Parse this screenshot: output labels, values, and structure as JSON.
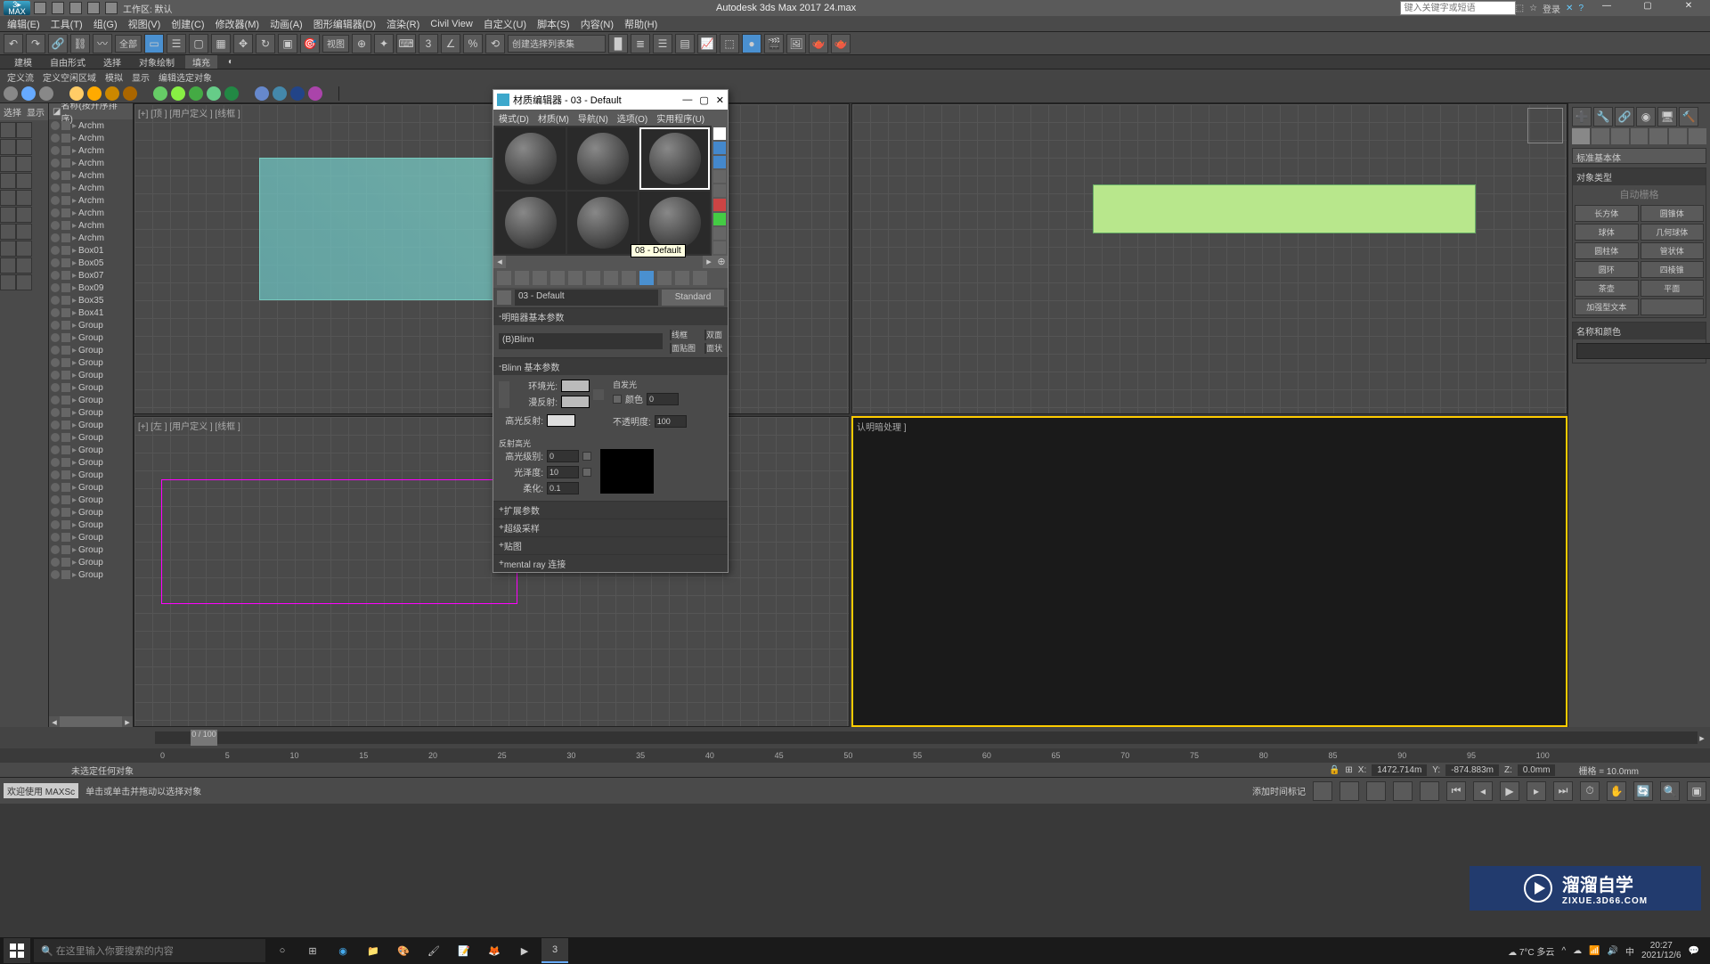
{
  "app": {
    "title_center": "Autodesk 3ds Max 2017    24.max",
    "workspace": "工作区: 默认",
    "search_placeholder": "键入关键字或短语",
    "login": "登录"
  },
  "menubar": [
    "编辑(E)",
    "工具(T)",
    "组(G)",
    "视图(V)",
    "创建(C)",
    "修改器(M)",
    "动画(A)",
    "图形编辑器(D)",
    "渲染(R)",
    "Civil View",
    "自定义(U)",
    "脚本(S)",
    "内容(N)",
    "帮助(H)"
  ],
  "toolbar": {
    "filter_label": "全部",
    "selection_label": "创建选择列表集",
    "view_label": "视图"
  },
  "ribbon": {
    "tabs": [
      "建模",
      "自由形式",
      "选择",
      "对象绘制",
      "填充"
    ],
    "sub": [
      "定义流",
      "定义空闲区域",
      "模拟",
      "显示",
      "编辑选定对象"
    ]
  },
  "scene": {
    "header": "名称(按升序排序)",
    "select": "选择",
    "display": "显示",
    "items": [
      "Archm",
      "Archm",
      "Archm",
      "Archm",
      "Archm",
      "Archm",
      "Archm",
      "Archm",
      "Archm",
      "Archm",
      "Box01",
      "Box05",
      "Box07",
      "Box09",
      "Box35",
      "Box41",
      "Group",
      "Group",
      "Group",
      "Group",
      "Group",
      "Group",
      "Group",
      "Group",
      "Group",
      "Group",
      "Group",
      "Group",
      "Group",
      "Group",
      "Group",
      "Group",
      "Group",
      "Group",
      "Group",
      "Group",
      "Group"
    ]
  },
  "viewports": {
    "vp1": "[+] [顶 ] [用户定义 ] [线框 ]",
    "vp2": "",
    "vp3": "[+] [左 ] [用户定义 ] [线框 ]",
    "vp4": "认明暗处理 ]"
  },
  "right": {
    "category": "标准基本体",
    "section1": "对象类型",
    "autogrid": "自动栅格",
    "buttons": [
      [
        "长方体",
        "圆锥体"
      ],
      [
        "球体",
        "几何球体"
      ],
      [
        "圆柱体",
        "管状体"
      ],
      [
        "圆环",
        "四棱锥"
      ],
      [
        "茶壶",
        "平面"
      ],
      [
        "加强型文本",
        ""
      ]
    ],
    "section2": "名称和颜色"
  },
  "mat": {
    "title": "材质编辑器 - 03 - Default",
    "menu": [
      "模式(D)",
      "材质(M)",
      "导航(N)",
      "选项(O)",
      "实用程序(U)"
    ],
    "tooltip": "08 - Default",
    "name": "03 - Default",
    "type": "Standard",
    "rollouts": {
      "shader": "明暗器基本参数",
      "shader_type": "(B)Blinn",
      "cb_wire": "线框",
      "cb_2side": "双面",
      "cb_facemap": "面贴图",
      "cb_faceted": "面状",
      "blinn": "Blinn 基本参数",
      "ambient": "环境光:",
      "diffuse": "漫反射:",
      "specular": "高光反射:",
      "selfillum": "自发光",
      "color_cb": "颜色",
      "color_val": "0",
      "opacity": "不透明度:",
      "opacity_val": "100",
      "spec_hl": "反射高光",
      "spec_level": "高光级别:",
      "spec_level_val": "0",
      "gloss": "光泽度:",
      "gloss_val": "10",
      "soften": "柔化:",
      "soften_val": "0.1",
      "ext": "扩展参数",
      "ss": "超级采样",
      "maps": "贴图",
      "mr": "mental ray 连接"
    }
  },
  "timeline": {
    "pos": "0 / 100",
    "ticks": [
      "0",
      "5",
      "10",
      "15",
      "20",
      "25",
      "30",
      "35",
      "40",
      "45",
      "50",
      "55",
      "60",
      "65",
      "70",
      "75",
      "80",
      "85",
      "90",
      "95",
      "100"
    ]
  },
  "status": {
    "line1": "未选定任何对象",
    "welcome": "欢迎使用 MAXSc",
    "line2": "单击或单击并拖动以选择对象",
    "x": "1472.714m",
    "y": "-874.883m",
    "z": "0.0mm",
    "grid": "栅格 = 10.0mm",
    "autokey": "添加时间标记"
  },
  "taskbar": {
    "search": "在这里输入你要搜索的内容",
    "weather": "7°C 多云",
    "time": "20:27",
    "date": "2021/12/6"
  },
  "watermark": {
    "brand": "溜溜自学",
    "url": "ZIXUE.3D66.COM"
  }
}
